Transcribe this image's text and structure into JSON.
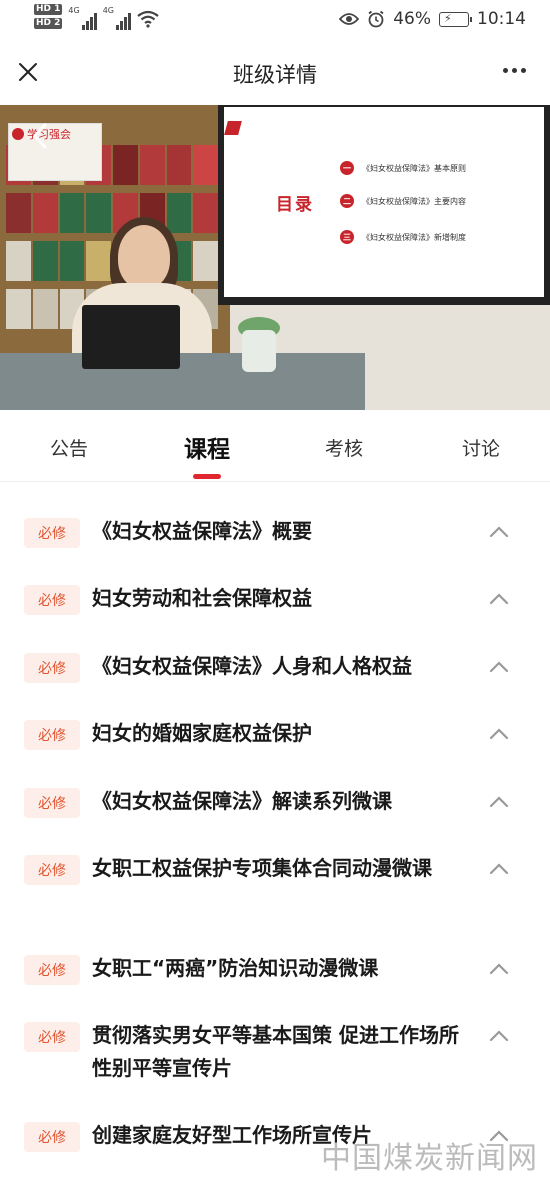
{
  "status_bar": {
    "sim1": "HD 1",
    "sim2": "HD 2",
    "net1": "4G",
    "net2": "4G",
    "battery": "46%",
    "time": "10:14"
  },
  "header": {
    "title": "班级详情"
  },
  "video": {
    "logo": "学习强会",
    "slide_title": "目录",
    "toc": [
      {
        "num": "一",
        "text": "《妇女权益保障法》基本原则"
      },
      {
        "num": "二",
        "text": "《妇女权益保障法》主要内容"
      },
      {
        "num": "三",
        "text": "《妇女权益保障法》新增制度"
      }
    ]
  },
  "tabs": [
    {
      "label": "公告",
      "active": false
    },
    {
      "label": "课程",
      "active": true
    },
    {
      "label": "考核",
      "active": false
    },
    {
      "label": "讨论",
      "active": false
    }
  ],
  "courses": [
    {
      "badge": "必修",
      "title": "《妇女权益保障法》概要"
    },
    {
      "badge": "必修",
      "title": "妇女劳动和社会保障权益"
    },
    {
      "badge": "必修",
      "title": "《妇女权益保障法》人身和人格权益"
    },
    {
      "badge": "必修",
      "title": "妇女的婚姻家庭权益保护"
    },
    {
      "badge": "必修",
      "title": "《妇女权益保障法》解读系列微课"
    },
    {
      "badge": "必修",
      "title": "女职工权益保护专项集体合同动漫微课"
    },
    {
      "badge": "必修",
      "title": "女职工“两癌”防治知识动漫微课"
    },
    {
      "badge": "必修",
      "title": "贯彻落实男女平等基本国策 促进工作场所性别平等宣传片"
    },
    {
      "badge": "必修",
      "title": "创建家庭友好型工作场所宣传片"
    }
  ],
  "watermark": "中国煤炭新闻网",
  "colors": {
    "accent": "#e0262f",
    "badge_bg": "#fdeee9",
    "badge_text": "#e0542f"
  }
}
